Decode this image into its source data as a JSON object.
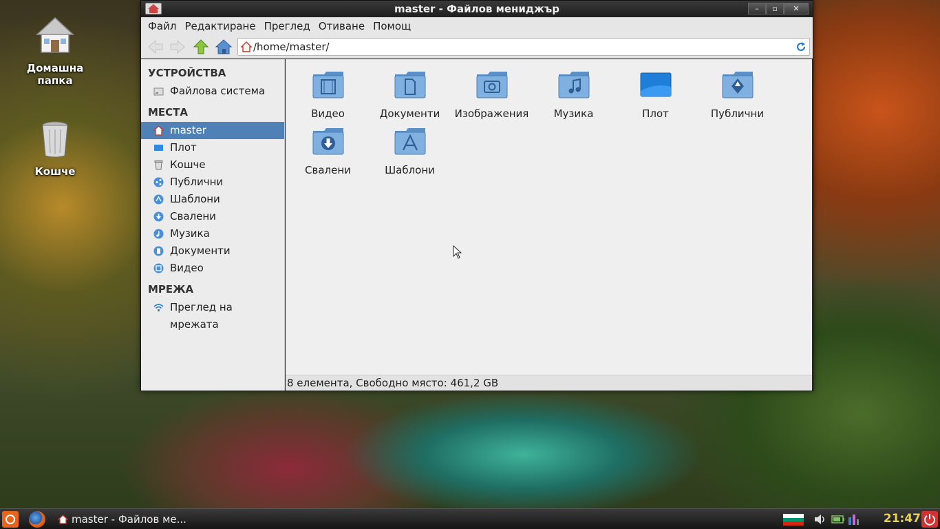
{
  "desktop": {
    "icons": [
      {
        "label": "Домашна папка"
      },
      {
        "label": "Кошче"
      }
    ]
  },
  "window": {
    "title": "master - Файлов мениджър",
    "controls": {
      "minimize": "–",
      "maximize": "▫",
      "close": "✕"
    }
  },
  "menu": {
    "file": "Файл",
    "edit": "Редактиране",
    "view": "Преглед",
    "go": "Отиване",
    "help": "Помощ"
  },
  "address": {
    "path": "/home/master/"
  },
  "sidebar": {
    "devices_header": "УСТРОЙСТВА",
    "devices": [
      {
        "label": "Файлова система",
        "icon": "drive-icon"
      }
    ],
    "places_header": "МЕСТА",
    "places": [
      {
        "label": "master",
        "icon": "home-icon",
        "active": true
      },
      {
        "label": "Плот",
        "icon": "desktop-icon"
      },
      {
        "label": "Кошче",
        "icon": "trash-icon"
      },
      {
        "label": "Публични",
        "icon": "share-icon"
      },
      {
        "label": "Шаблони",
        "icon": "templates-icon"
      },
      {
        "label": "Свалени",
        "icon": "download-icon"
      },
      {
        "label": "Музика",
        "icon": "music-icon"
      },
      {
        "label": "Документи",
        "icon": "document-icon"
      },
      {
        "label": "Видео",
        "icon": "video-icon"
      }
    ],
    "network_header": "МРЕЖА",
    "network": [
      {
        "label": "Преглед на мрежата",
        "icon": "wifi-icon"
      }
    ]
  },
  "files": [
    {
      "label": "Видео",
      "icon": "folder-video-icon"
    },
    {
      "label": "Документи",
      "icon": "folder-documents-icon"
    },
    {
      "label": "Изображения",
      "icon": "folder-pictures-icon"
    },
    {
      "label": "Музика",
      "icon": "folder-music-icon"
    },
    {
      "label": "Плот",
      "icon": "desktop-icon"
    },
    {
      "label": "Публични",
      "icon": "folder-public-icon"
    },
    {
      "label": "Свалени",
      "icon": "folder-download-icon"
    },
    {
      "label": "Шаблони",
      "icon": "folder-templates-icon"
    }
  ],
  "status": {
    "text": "8 елемента, Свободно място: 461,2 GB"
  },
  "taskbar": {
    "task_label": "master - Файлов ме...",
    "clock": "21:47"
  },
  "colors": {
    "selection": "#5081b6",
    "folder": "#6f9fd0",
    "clock": "#e8d34a"
  }
}
